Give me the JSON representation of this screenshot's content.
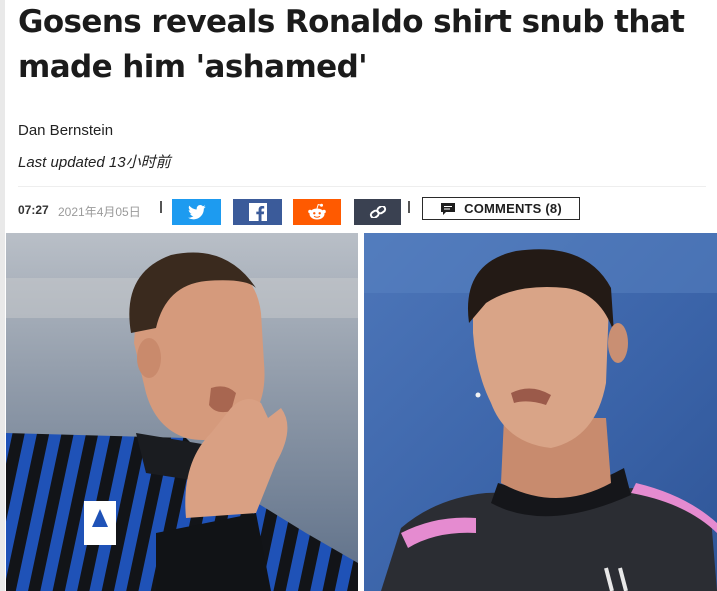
{
  "article": {
    "headline": "Gosens reveals Ronaldo shirt snub that made him 'ashamed'",
    "author": "Dan Bernstein",
    "updated": "Last updated 13小时前",
    "time": "07:27",
    "date": "2021年4月05日"
  },
  "share": {
    "icons": [
      "twitter-icon",
      "facebook-icon",
      "reddit-icon",
      "link-icon"
    ]
  },
  "comments": {
    "label": "COMMENTS (8)"
  },
  "hero_image": {
    "description_left": "Atalanta player in black-blue striped kit, hands raised to mouth",
    "description_right": "Cristiano Ronaldo in dark Juventus kit with pink trim",
    "colors": {
      "left_bg": "#9fa9b6",
      "right_bg": "#3a63a8",
      "atalanta_blue": "#1f52b7",
      "juve_pink": "#e58bd0"
    }
  }
}
